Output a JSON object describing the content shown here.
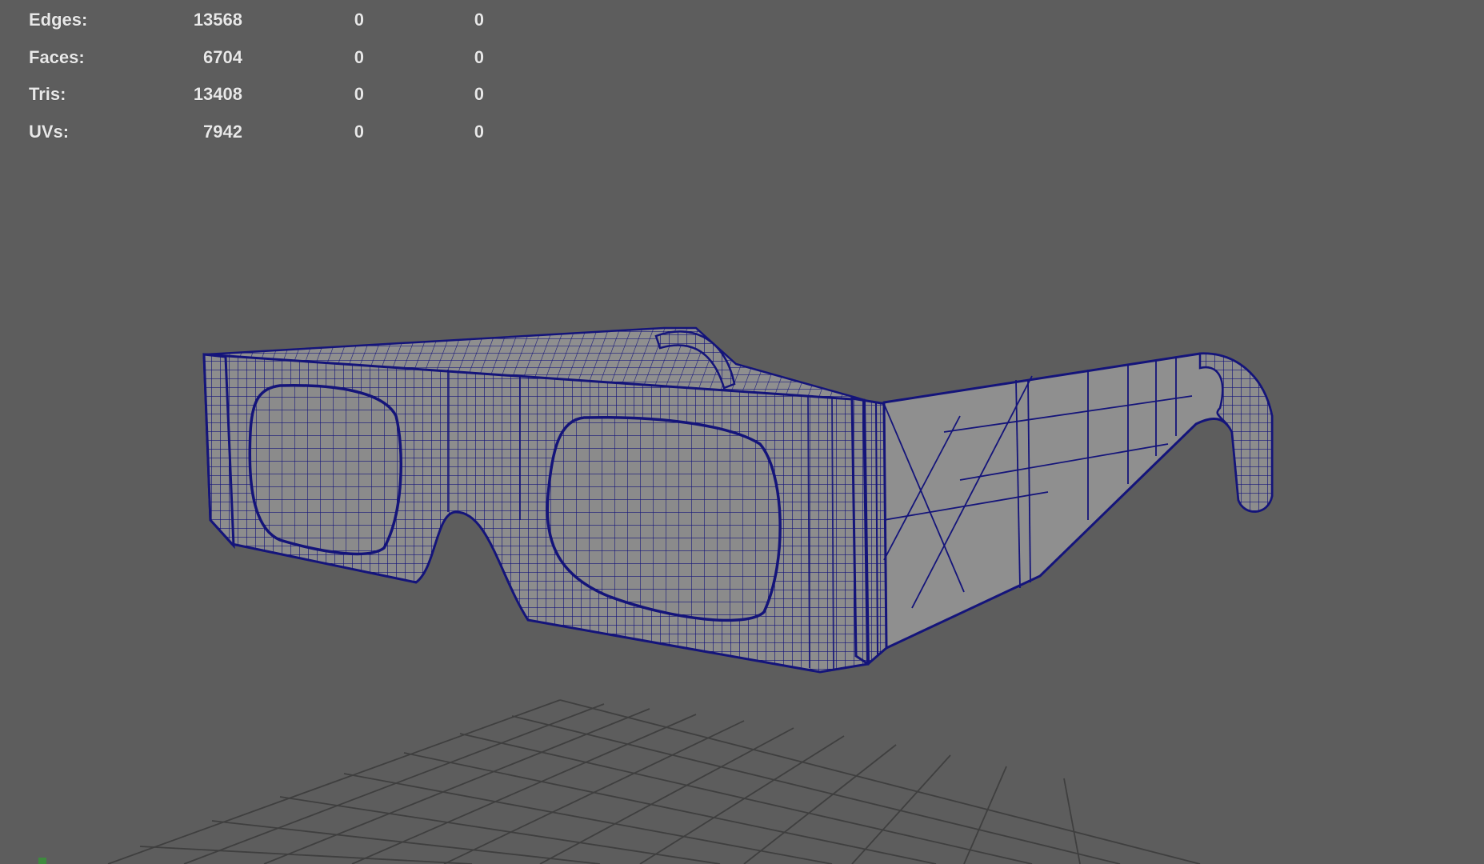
{
  "hud": {
    "rows": [
      {
        "label": "Edges:",
        "total": "13568",
        "selected": "0",
        "selected_uv": "0"
      },
      {
        "label": "Faces:",
        "total": "6704",
        "selected": "0",
        "selected_uv": "0"
      },
      {
        "label": "Tris:",
        "total": "13408",
        "selected": "0",
        "selected_uv": "0"
      },
      {
        "label": "UVs:",
        "total": "7942",
        "selected": "0",
        "selected_uv": "0"
      }
    ]
  },
  "viewport": {
    "background_color": "#5d5d5d",
    "wireframe_color": "#14147a",
    "surface_color": "#8d8d8d",
    "grid_color": "#3f3f3f",
    "model_icon": "3d-glasses-wireframe-icon"
  }
}
